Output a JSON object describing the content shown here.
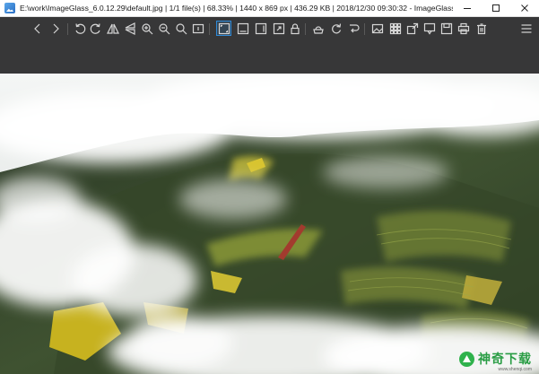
{
  "window": {
    "title": "E:\\work\\ImageGlass_6.0.12.29\\default.jpg  |  1/1 file(s)  |  68.33%  |  1440 x 869 px  |  436.29 KB  |  2018/12/30 09:30:32  -  ImageGlass",
    "controls": [
      "minimize-icon",
      "maximize-icon",
      "close-icon"
    ]
  },
  "toolbar": {
    "buttons": [
      {
        "icon": "previous-icon"
      },
      {
        "icon": "next-icon"
      },
      {
        "icon": "rotate-left-icon"
      },
      {
        "icon": "rotate-right-icon"
      },
      {
        "icon": "flip-horizontal-icon"
      },
      {
        "icon": "flip-vertical-icon"
      },
      {
        "icon": "zoom-in-icon"
      },
      {
        "icon": "zoom-out-icon"
      },
      {
        "icon": "zoom-to-fit-icon"
      },
      {
        "icon": "actual-size-icon"
      },
      {
        "icon": "lock-zoom-icon"
      },
      {
        "icon": "scale-to-width-icon",
        "active": true
      },
      {
        "icon": "scale-to-height-icon"
      },
      {
        "icon": "scale-to-fill-icon"
      },
      {
        "icon": "auto-zoom-icon"
      },
      {
        "icon": "lock-icon"
      },
      {
        "icon": "slideshow-icon"
      },
      {
        "icon": "refresh-icon"
      },
      {
        "icon": "goto-icon"
      },
      {
        "icon": "gallery-icon"
      },
      {
        "icon": "thumbnail-icon"
      },
      {
        "icon": "fullscreen-icon"
      },
      {
        "icon": "checkerboard-icon"
      },
      {
        "icon": "open-icon"
      },
      {
        "icon": "save-icon"
      },
      {
        "icon": "print-icon"
      },
      {
        "icon": "delete-icon"
      },
      {
        "icon": "menu-icon"
      }
    ]
  },
  "watermark": {
    "text": "神奇下载",
    "sub": "www.shenqi.com"
  },
  "colors": {
    "toolbar_bg": "#373738",
    "active_border": "#2f8ad8",
    "icon": "#d6d6d6"
  }
}
